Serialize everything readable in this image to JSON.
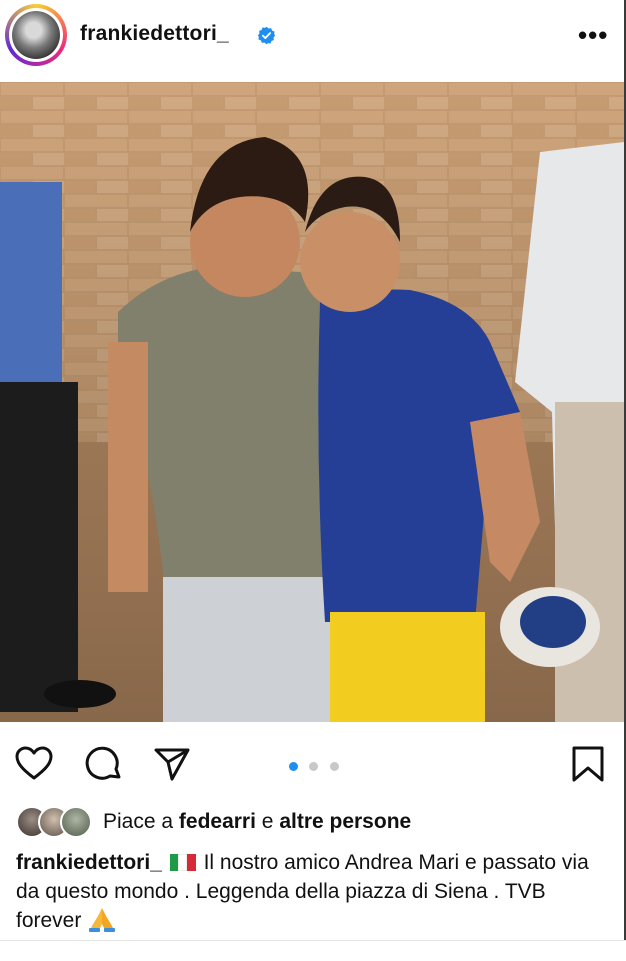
{
  "post": {
    "username": "frankiedettori_",
    "verified": true
  },
  "carousel": {
    "total": 3,
    "active_index": 0,
    "active_color": "#1f8ef1"
  },
  "likes": {
    "prefix": "Piace a",
    "user": "fedearri",
    "joiner": "e",
    "others": "altre persone"
  },
  "caption": {
    "username": "frankiedettori_",
    "text": "Il nostro amico Andrea Mari e passato via da questo mondo . Leggenda della piazza di Siena . TVB forever",
    "flag": "it-flag-emoji",
    "emoji": "praying-hands-emoji"
  },
  "icons": {
    "like": "heart-icon",
    "comment": "comment-icon",
    "share": "send-icon",
    "save": "bookmark-icon",
    "more": "more-icon",
    "verified": "verified-badge-icon"
  },
  "colors": {
    "verified_blue": "#1f8ef1",
    "text": "#111111"
  }
}
